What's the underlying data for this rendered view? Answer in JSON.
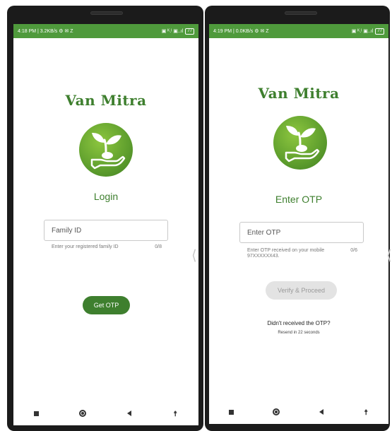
{
  "brand": {
    "title": "Van Mitra",
    "accent": "#3e7f2e",
    "status_bar_color": "#4f9a3c"
  },
  "screen1": {
    "status": {
      "left": "4:18 PM | 3.2KB/s ⚙ ✉ Z",
      "right": "▣ ᴷ.ᴵ ▣..ıl",
      "battery": "77"
    },
    "heading": "Login",
    "field": {
      "placeholder": "Family ID"
    },
    "helper": {
      "message": "Enter your registered family ID",
      "counter": "0/8"
    },
    "button": "Get OTP"
  },
  "screen2": {
    "status": {
      "left": "4:19 PM | 0.0KB/s ⚙ ✉ Z",
      "right": "▣ ᴷ.ᴵ ▣..ıl",
      "battery": "77"
    },
    "heading": "Enter OTP",
    "field": {
      "placeholder": "Enter OTP"
    },
    "helper": {
      "message": "Enter OTP received on your mobile 97XXXXXX43.",
      "counter": "0/6"
    },
    "button": "Verify & Proceed",
    "notice": "Didn't received the OTP?",
    "resend": "Resend in 22 seconds"
  },
  "icons": [
    "logo-icon",
    "recent-apps-icon",
    "home-icon",
    "back-icon",
    "accessibility-icon"
  ]
}
